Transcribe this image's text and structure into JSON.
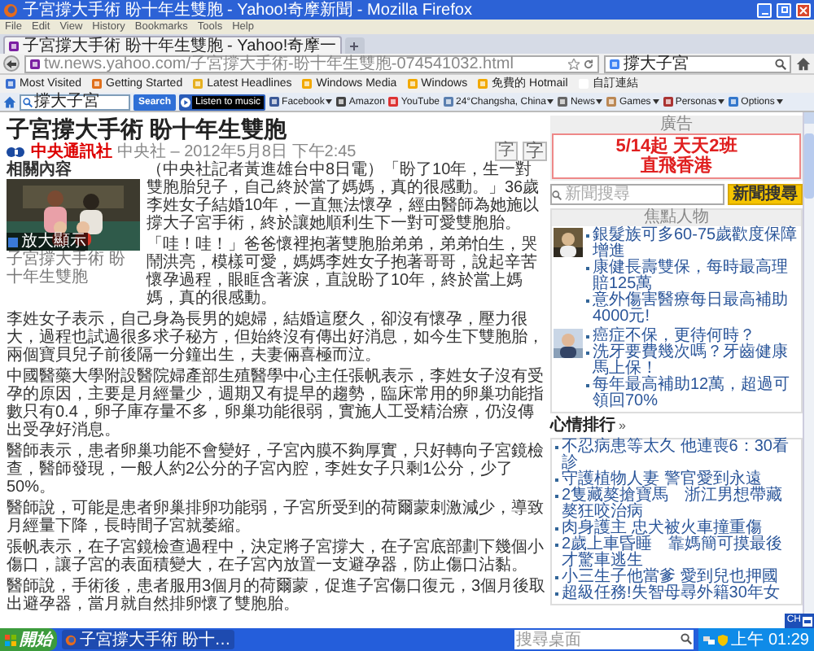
{
  "window": {
    "title": "子宮撐大手術 盼十年生雙胞 - Yahoo!奇摩新聞 - Mozilla Firefox"
  },
  "menu": [
    "File",
    "Edit",
    "View",
    "History",
    "Bookmarks",
    "Tools",
    "Help"
  ],
  "tabs": [
    {
      "label": "子宮撐大手術 盼十年生雙胞 - Yahoo!奇摩一",
      "selected": true
    }
  ],
  "address_bar": {
    "url": "tw.news.yahoo.com/子宮撐大手術-盼十年生雙胞-074541032.html"
  },
  "search_bar": {
    "value": "撐大子宮"
  },
  "bookmarks": [
    "Most Visited",
    "Getting Started",
    "Latest Headlines",
    "Windows Media",
    "Windows",
    "免費的 Hotmail",
    "自訂連結"
  ],
  "toolbar": {
    "search_value": "撐大子宮",
    "search_button": "Search",
    "music": "Listen to music",
    "items": [
      {
        "label": "Facebook",
        "dropdown": true
      },
      {
        "label": "Amazon",
        "dropdown": false
      },
      {
        "label": "YouTube",
        "dropdown": false
      },
      {
        "label": "24°Changsha, China",
        "dropdown": true
      },
      {
        "label": "News",
        "dropdown": true
      },
      {
        "label": "Games",
        "dropdown": true
      },
      {
        "label": "Personas",
        "dropdown": true
      },
      {
        "label": "Options",
        "dropdown": true
      }
    ]
  },
  "article": {
    "title": "子宮撐大手術 盼十年生雙胞",
    "source": "中央通訊社",
    "byline": "中央社 – 2012年5月8日 下午2:45",
    "font_buttons": [
      "字",
      "字"
    ],
    "related_label": "相關內容",
    "photo_button": "放大顯示",
    "photo_caption": "子宮撐大手術 盼十年生雙胞",
    "paragraphs": [
      "（中央社記者黃進雄台中8日電）「盼了10年，生一對雙胞胎兒子，自己終於當了媽媽，真的很感動。」36歲李姓女子結婚10年，一直無法懷孕，經由醫師為她施以撐大子宮手術，終於讓她順利生下一對可愛雙胞胎。",
      "「哇！哇！」爸爸懷裡抱著雙胞胎弟弟，弟弟怕生，哭鬧洪亮，模樣可愛，媽媽李姓女子抱著哥哥，說起辛苦懷孕過程，眼眶含著淚，直說盼了10年，終於當上媽媽，真的很感動。",
      "李姓女子表示，自己身為長男的媳婦，結婚這麼久，卻沒有懷孕，壓力很大，過程也試過很多求子秘方，但始終沒有傳出好消息，如今生下雙胞胎，兩個寶貝兒子前後隔一分鐘出生，夫妻倆喜極而泣。",
      "中國醫藥大學附設醫院婦產部生殖醫學中心主任張帆表示，李姓女子沒有受孕的原因，主要是月經量少，週期又有提早的趨勢，臨床常用的卵巢功能指數只有0.4，卵子庫存量不多，卵巢功能很弱，實施人工受精治療，仍沒傳出受孕好消息。",
      "醫師表示，患者卵巢功能不會變好，子宮內膜不夠厚實，只好轉向子宮鏡檢查，醫師發現，一般人約2公分的子宮內腔，李姓女子只剩1公分，少了50%。",
      "醫師說，可能是患者卵巢排卵功能弱，子宮所受到的荷爾蒙刺激減少，導致月經量下降，長時間子宮就萎縮。",
      "張帆表示，在子宮鏡檢查過程中，決定將子宮撐大，在子宮底部劃下幾個小傷口，讓子宮的表面積變大，在子宮內放置一支避孕器，防止傷口沾黏。",
      "醫師說，手術後，患者服用3個月的荷爾蒙，促進子宮傷口復元，3個月後取出避孕器，當月就自然排卵懷了雙胞胎。"
    ]
  },
  "sidebar": {
    "ad_label": "廣告",
    "ad_lines": [
      "5/14起 天天2班",
      "直飛香港"
    ],
    "search": {
      "placeholder": "新聞搜尋",
      "button": "新聞搜尋"
    },
    "featured": {
      "title": "焦點人物",
      "groups": [
        {
          "items": [
            "銀髮族可多60-75歲歡度保障增進",
            "康健長壽雙保，每時最高理賠125萬",
            "意外傷害醫療每日最高補助4000元!"
          ]
        },
        {
          "items": [
            "癌症不保，更待何時？",
            "洗牙要費幾次嗎？牙齒健康馬上保！",
            "每年最高補助12萬，超過可領回70%"
          ]
        }
      ]
    },
    "mood": {
      "title": "心情排行",
      "more": "»",
      "items": [
        "不忍病患等太久 他連喪6：30看診",
        "守護植物人妻 警官愛到永遠",
        "2隻藏獒搶寶馬　浙江男想帶藏獒狂咬治病",
        "肉身護主 忠犬被火車撞重傷",
        "2歲上車昏睡　靠媽簡可摸最後才驚車逃生",
        "小三生子他當爹 愛到兒也押國",
        "超級任務!失智母尋外籍30年女"
      ]
    }
  },
  "taskbar": {
    "start": "開始",
    "tasks": [
      {
        "label": "子宮撐大手術 盼十…",
        "selected": true
      }
    ],
    "desktop_search_placeholder": "搜尋桌面",
    "clock": "上午 01:29",
    "language": "CH"
  }
}
